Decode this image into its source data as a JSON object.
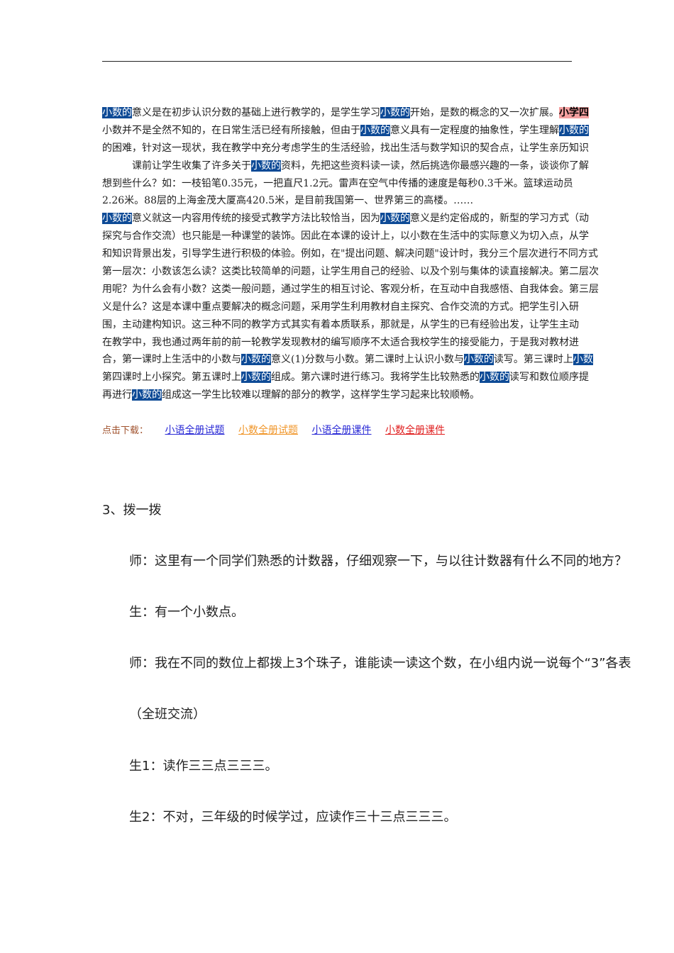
{
  "lines": [
    [
      {
        "t": "小数的",
        "h": "blue"
      },
      {
        "t": "意义是在初步认识分数的基础上进行教学的，是学生学习"
      },
      {
        "t": "小数的",
        "h": "blue"
      },
      {
        "t": "开始，是数的概念的又一次扩展。"
      },
      {
        "t": "小学四",
        "h": "pink"
      }
    ],
    [
      {
        "t": "小数并不是全然不知的，在日常生活已经有所接触，但由于"
      },
      {
        "t": "小数的",
        "h": "blue"
      },
      {
        "t": "意义具有一定程度的抽象性，学生理解"
      },
      {
        "t": "小数的",
        "h": "blue"
      }
    ],
    [
      {
        "t": "的困难，针对这一现状，我在教学中充分考虑学生的生活经验，找出生活与数学知识的契合点，让学生亲历知识"
      }
    ],
    [
      {
        "t": "　　　课前让学生收集了许多关于"
      },
      {
        "t": "小数的",
        "h": "blue"
      },
      {
        "t": "资料，先把这些资料读一读，然后挑选你最感兴趣的一条，谈谈你了解"
      }
    ],
    [
      {
        "t": "想到些什么？如：一枝铅笔0.35元，一把直尺1.2元。雷声在空气中传播的速度是每秒0.3千米。篮球运动员"
      }
    ],
    [
      {
        "t": "2.26米。88层的上海金茂大厦高420.5米，是目前我国第一、世界第三的高楼。……"
      }
    ],
    [
      {
        "t": "小数的",
        "h": "blue"
      },
      {
        "t": "意义就这一内容用传统的接受式教学方法比较恰当，因为"
      },
      {
        "t": "小数的",
        "h": "blue"
      },
      {
        "t": "意义是约定俗成的，新型的学习方式（动"
      }
    ],
    [
      {
        "t": "探究与合作交流）也只能是一种课堂的装饰。因此在本课的设计上，以小数在生活中的实际意义为切入点，从学"
      }
    ],
    [
      {
        "t": "和知识背景出发，引导学生进行积极的体验。例如，在\"提出问题、解决问题\"设计时，我分三个层次进行不同方式"
      }
    ],
    [
      {
        "t": "第一层次：小数该怎么读？这类比较简单的问题，让学生用自己的经验、以及个别与集体的读直接解决。第二层次"
      }
    ],
    [
      {
        "t": "用呢？为什么会有小数？这类一般问题，通过学生的相互讨论、客观分析，在互动中自我感悟、自我体会。第三层"
      }
    ],
    [
      {
        "t": "义是什么？这是本课中重点要解决的概念问题，采用学生利用教材自主探究、合作交流的方式。把学生引入研"
      }
    ],
    [
      {
        "t": "围，主动建构知识。这三种不同的教学方式其实有着本质联系，那就是，从学生的已有经验出发，让学生主动"
      }
    ],
    [
      {
        "t": "在教学中，我也通过两年前的前一轮教学发现教材的编写顺序不太适合我校学生的接受能力，于是我对教材进"
      }
    ],
    [
      {
        "t": "合，第一课时上生活中的小数与"
      },
      {
        "t": "小数的",
        "h": "blue"
      },
      {
        "t": "意义(1)分数与小数。第二课时上认识小数与"
      },
      {
        "t": "小数的",
        "h": "blue"
      },
      {
        "t": "读写。第三课时上"
      },
      {
        "t": "小数",
        "h": "blue"
      }
    ],
    [
      {
        "t": "第四课时上小探究。第五课时上"
      },
      {
        "t": "小数的",
        "h": "blue"
      },
      {
        "t": "组成。第六课时进行练习。我将学生比较熟悉的"
      },
      {
        "t": "小数的",
        "h": "blue"
      },
      {
        "t": "读写和数位顺序提"
      }
    ],
    [
      {
        "t": "再进行"
      },
      {
        "t": "小数的",
        "h": "blue"
      },
      {
        "t": "组成这一学生比较难以理解的部分的教学，这样学生学习起来比较顺畅。"
      }
    ]
  ],
  "downloads": {
    "label": "点击下载：",
    "links": [
      {
        "text": "小语全册试题",
        "color": "#2b2bd6"
      },
      {
        "text": "小数全册试题",
        "color": "#f0962a"
      },
      {
        "text": "小语全册课件",
        "color": "#2b2bd6"
      },
      {
        "text": "小数全册课件",
        "color": "#e02020"
      }
    ]
  },
  "section": {
    "heading": "3、拨一拨",
    "items": [
      "师：这里有一个同学们熟悉的计数器，仔细观察一下，与以往计数器有什么不同的地方？",
      "生：有一个小数点。",
      "师：我在不同的数位上都拨上3个珠子，谁能读一读这个数，在小组内说一说每个“3”各表",
      "（全班交流）",
      "生1：读作三三点三三三。",
      "生2：不对，三年级的时候学过，应读作三十三点三三三。"
    ]
  }
}
